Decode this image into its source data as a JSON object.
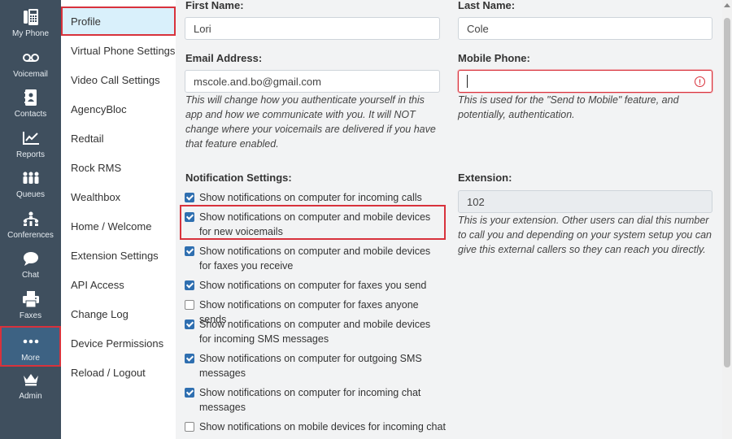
{
  "rail": {
    "items": [
      {
        "label": "My Phone",
        "icon": "phone-icon"
      },
      {
        "label": "Voicemail",
        "icon": "voicemail-icon"
      },
      {
        "label": "Contacts",
        "icon": "contacts-icon"
      },
      {
        "label": "Reports",
        "icon": "reports-icon"
      },
      {
        "label": "Queues",
        "icon": "queues-icon"
      },
      {
        "label": "Conferences",
        "icon": "conferences-icon"
      },
      {
        "label": "Chat",
        "icon": "chat-icon"
      },
      {
        "label": "Faxes",
        "icon": "fax-icon"
      },
      {
        "label": "More",
        "icon": "more-icon"
      },
      {
        "label": "Admin",
        "icon": "crown-icon"
      }
    ],
    "active": "More"
  },
  "submenu": {
    "items": [
      {
        "label": "Profile"
      },
      {
        "label": "Virtual Phone Settings"
      },
      {
        "label": "Video Call Settings"
      },
      {
        "label": "AgencyBloc"
      },
      {
        "label": "Redtail"
      },
      {
        "label": "Rock RMS"
      },
      {
        "label": "Wealthbox"
      },
      {
        "label": "Home / Welcome"
      },
      {
        "label": "Extension Settings"
      },
      {
        "label": "API Access"
      },
      {
        "label": "Change Log"
      },
      {
        "label": "Device Permissions"
      },
      {
        "label": "Reload / Logout"
      }
    ],
    "active": "Profile"
  },
  "form": {
    "first_name": {
      "label": "First Name:",
      "value": "Lori"
    },
    "last_name": {
      "label": "Last Name:",
      "value": "Cole"
    },
    "email": {
      "label": "Email Address:",
      "value": "mscole.and.bo@gmail.com",
      "help": "This will change how you authenticate yourself in this app and how we communicate with you. It will NOT change where your voicemails are delivered if you have that feature enabled."
    },
    "mobile": {
      "label": "Mobile Phone:",
      "value": "",
      "help": "This is used for the \"Send to Mobile\" feature, and potentially, authentication."
    },
    "extension": {
      "label": "Extension:",
      "value": "102",
      "help": "This is your extension. Other users can dial this number to call you and depending on your system setup you can give this external callers so they can reach you directly."
    }
  },
  "notifications": {
    "label": "Notification Settings:",
    "items": [
      {
        "text": "Show notifications on computer for incoming calls",
        "checked": true
      },
      {
        "text": "Show notifications on computer and mobile devices for new voicemails",
        "checked": true
      },
      {
        "text": "Show notifications on computer and mobile devices for faxes you receive",
        "checked": true
      },
      {
        "text": "Show notifications on computer for faxes you send",
        "checked": true
      },
      {
        "text": "Show notifications on computer for faxes anyone sends",
        "checked": false
      },
      {
        "text": "Show notifications on computer and mobile devices for incoming SMS messages",
        "checked": true
      },
      {
        "text": "Show notifications on computer for outgoing SMS messages",
        "checked": true
      },
      {
        "text": "Show notifications on computer for incoming chat messages",
        "checked": true
      },
      {
        "text": "Show notifications on mobile devices for incoming chat",
        "checked": false
      }
    ]
  },
  "colors": {
    "rail_bg": "#3f4f5e",
    "rail_active": "#3d6283",
    "highlight": "#d8323c",
    "checkbox": "#2f6fb0",
    "submenu_active": "#d9f0fb"
  }
}
